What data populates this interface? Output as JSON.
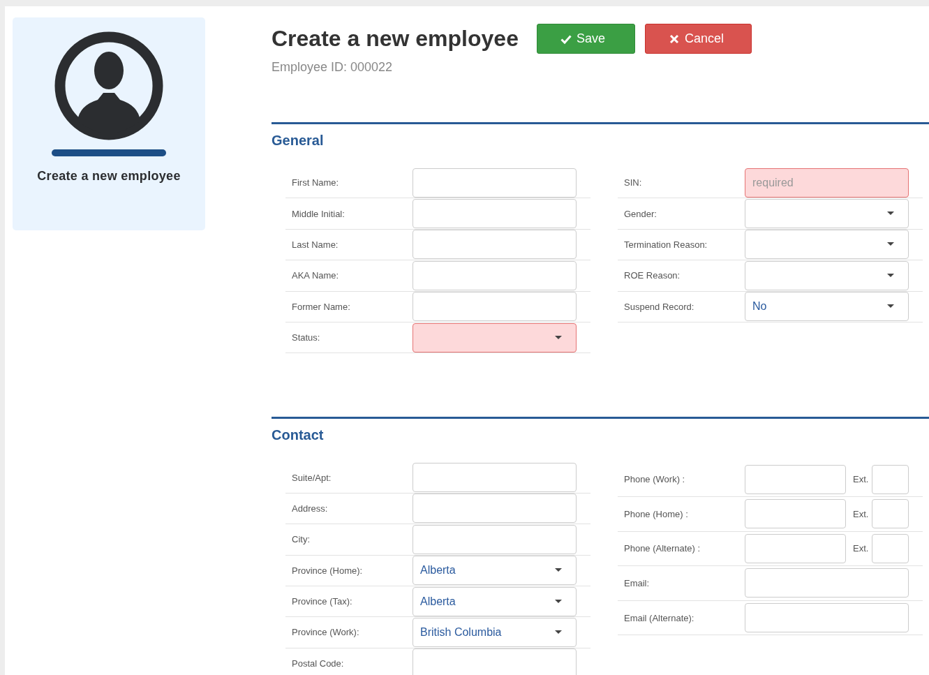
{
  "sidebar": {
    "title": "Create a new employee"
  },
  "header": {
    "title": "Create a new employee",
    "employee_id": "Employee ID: 000022",
    "buttons": [
      {
        "label": "Save",
        "kind": "save"
      },
      {
        "label": "Cancel",
        "kind": "cancel"
      }
    ]
  },
  "sections": [
    {
      "title": "General",
      "columns": [
        [
          {
            "label": "First Name:",
            "kind": "text",
            "invalid": false
          },
          {
            "label": "Middle Initial:",
            "kind": "text",
            "invalid": false
          },
          {
            "label": "Last Name:",
            "kind": "text",
            "invalid": false
          },
          {
            "label": "AKA Name:",
            "kind": "text",
            "invalid": false
          },
          {
            "label": "Former Name:",
            "kind": "text",
            "invalid": false
          },
          {
            "label": "Status:",
            "kind": "select",
            "invalid": true
          }
        ],
        [
          {
            "label": "SIN:",
            "kind": "text",
            "invalid": true,
            "placeholder": "required"
          },
          {
            "label": "Gender:",
            "kind": "select",
            "invalid": false
          },
          {
            "label": "Termination Reason:",
            "kind": "select",
            "invalid": false
          },
          {
            "label": "ROE Reason:",
            "kind": "select",
            "invalid": false
          },
          {
            "label": "Suspend Record:",
            "kind": "select",
            "invalid": false,
            "value": "No"
          }
        ]
      ]
    },
    {
      "title": "Contact",
      "columns": [
        [
          {
            "label": "Suite/Apt:",
            "kind": "text",
            "invalid": false
          },
          {
            "label": "Address:",
            "kind": "text",
            "invalid": false
          },
          {
            "label": "City:",
            "kind": "text",
            "invalid": false
          },
          {
            "label": "Province (Home):",
            "kind": "select",
            "invalid": false,
            "value": "Alberta"
          },
          {
            "label": "Province (Tax):",
            "kind": "select",
            "invalid": false,
            "value": "Alberta"
          },
          {
            "label": "Province (Work):",
            "kind": "select",
            "invalid": false,
            "value": "British Columbia"
          },
          {
            "label": "Postal Code:",
            "kind": "text",
            "invalid": false
          }
        ],
        [
          {
            "label": "Phone (Work) :",
            "kind": "phone",
            "invalid": false,
            "ext_label": "Ext."
          },
          {
            "label": "Phone (Home) :",
            "kind": "phone",
            "invalid": false,
            "ext_label": "Ext."
          },
          {
            "label": "Phone (Alternate) :",
            "kind": "phone",
            "invalid": false,
            "ext_label": "Ext."
          },
          {
            "label": "Email:",
            "kind": "text",
            "invalid": false
          },
          {
            "label": "Email (Alternate):",
            "kind": "text",
            "invalid": false
          }
        ]
      ]
    }
  ]
}
